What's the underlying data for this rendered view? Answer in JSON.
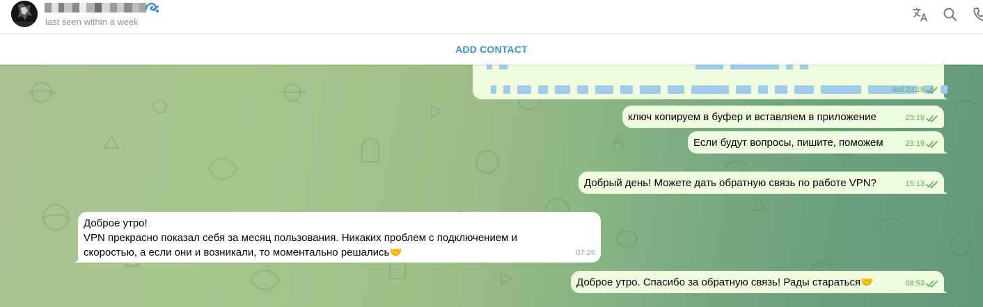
{
  "header": {
    "status": "last seen within a week",
    "icons": [
      "translate-icon",
      "search-icon",
      "phone-icon"
    ]
  },
  "add_contact": {
    "label": "ADD CONTACT"
  },
  "messages": [
    {
      "id": "m0",
      "direction": "out",
      "text": "",
      "time": "ted 23:18",
      "read": true,
      "content_obscured": true
    },
    {
      "id": "m1",
      "direction": "out",
      "text": "ключ копируем в буфер и вставляем в приложение",
      "time": "23:19",
      "read": true
    },
    {
      "id": "m2",
      "direction": "out",
      "text": "Если будут вопросы, пишите, поможем",
      "time": "23:19",
      "read": true
    },
    {
      "id": "m3",
      "direction": "out",
      "text": "Добрый день! Можете дать обратную связь по работе VPN?",
      "time": "15:13",
      "read": true
    },
    {
      "id": "m4",
      "direction": "in",
      "lines": [
        "Доброе утро!",
        "VPN прекрасно показал себя за месяц пользования. Никаких проблем с подключением и",
        "скоростью, а если они и возникали, то моментально решались🤝"
      ],
      "time": "07:26"
    },
    {
      "id": "m5",
      "direction": "out",
      "text": "Доброе утро. Спасибо за обратную связь! Рады стараться🤝",
      "time": "08:53",
      "read": true
    }
  ],
  "colors": {
    "accent": "#3a8fd4",
    "outgoing_bubble": "#effdde",
    "incoming_bubble": "#ffffff",
    "read_check": "#5dab59"
  }
}
